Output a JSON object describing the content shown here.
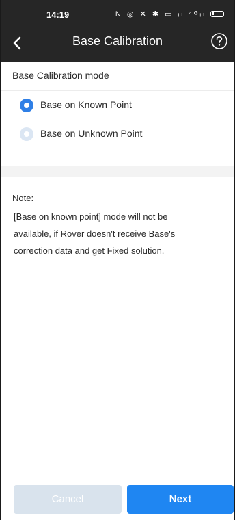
{
  "status_bar": {
    "time": "14:19",
    "icons_text": "N ◎ ✕ ✱ ▭ ᵢₗ ⁴ᴳᵢₗ"
  },
  "header": {
    "title": "Base Calibration"
  },
  "section": {
    "label": "Base Calibration mode"
  },
  "options": [
    {
      "label": "Base on Known Point",
      "selected": true
    },
    {
      "label": "Base on Unknown Point",
      "selected": false
    }
  ],
  "note": {
    "title": "Note:",
    "lines": [
      "[Base on known point] mode will not be",
      "available, if Rover doesn't receive Base's",
      "correction data and get Fixed solution."
    ]
  },
  "footer": {
    "cancel_label": "Cancel",
    "next_label": "Next"
  },
  "colors": {
    "header_bg": "#262626",
    "accent": "#1f86f2",
    "radio_selected": "#2f7fe6",
    "radio_unselected": "#dbe6f3",
    "cancel_bg": "#d9e3ed"
  }
}
